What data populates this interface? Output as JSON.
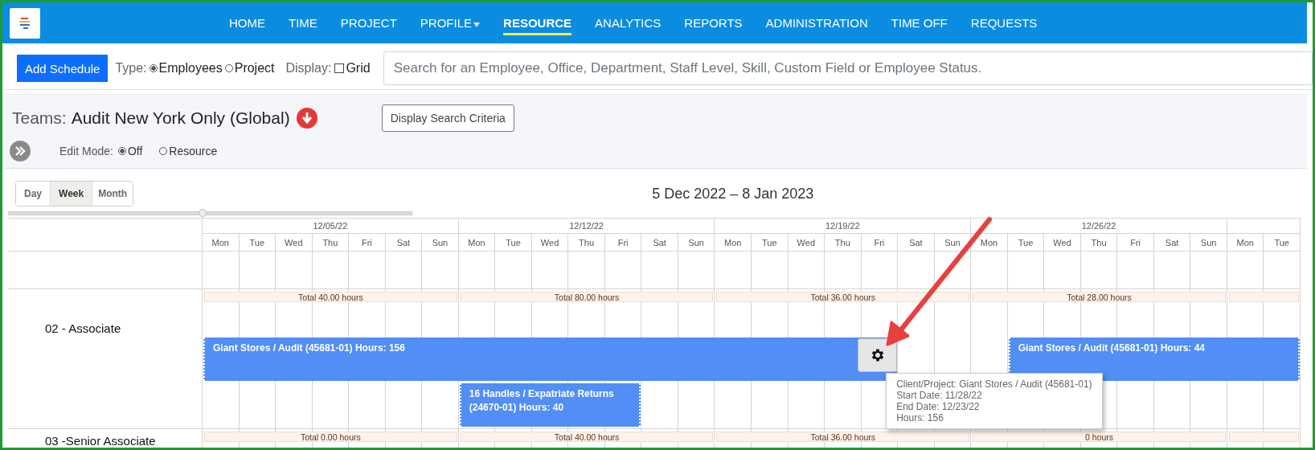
{
  "nav": {
    "items": [
      {
        "label": "HOME",
        "selected": false,
        "dropdown": false
      },
      {
        "label": "TIME",
        "selected": false,
        "dropdown": false
      },
      {
        "label": "PROJECT",
        "selected": false,
        "dropdown": false
      },
      {
        "label": "PROFILE",
        "selected": false,
        "dropdown": true
      },
      {
        "label": "RESOURCE",
        "selected": true,
        "dropdown": false
      },
      {
        "label": "ANALYTICS",
        "selected": false,
        "dropdown": false
      },
      {
        "label": "REPORTS",
        "selected": false,
        "dropdown": false
      },
      {
        "label": "ADMINISTRATION",
        "selected": false,
        "dropdown": false
      },
      {
        "label": "TIME OFF",
        "selected": false,
        "dropdown": false
      },
      {
        "label": "REQUESTS",
        "selected": false,
        "dropdown": false
      }
    ]
  },
  "toolbar": {
    "add_button": "Add Schedule",
    "type_label": "Type:",
    "type_options": [
      {
        "label": "Employees",
        "selected": true
      },
      {
        "label": "Project",
        "selected": false
      }
    ],
    "display_label": "Display:",
    "grid_option": {
      "label": "Grid",
      "checked": false
    },
    "search": {
      "placeholder": "Search for an Employee, Office, Department, Staff Level, Skill, Custom Field or Employee Status."
    }
  },
  "teams": {
    "label": "Teams:",
    "value": "Audit New York Only (Global)",
    "criteria_button": "Display Search Criteria"
  },
  "edit_mode": {
    "label": "Edit Mode:",
    "options": [
      {
        "label": "Off",
        "selected": true
      },
      {
        "label": "Resource",
        "selected": false
      }
    ]
  },
  "view_buttons": [
    {
      "label": "Day",
      "selected": false
    },
    {
      "label": "Week",
      "selected": true
    },
    {
      "label": "Month",
      "selected": false
    }
  ],
  "date_range": "5 Dec 2022 – 8 Jan 2023",
  "zoom_slider": {
    "level": 0.48
  },
  "timeline": {
    "weeks": [
      {
        "date": "12/05/22",
        "days": [
          "Mon",
          "Tue",
          "Wed",
          "Thu",
          "Fri",
          "Sat",
          "Sun"
        ]
      },
      {
        "date": "12/12/22",
        "days": [
          "Mon",
          "Tue",
          "Wed",
          "Thu",
          "Fri",
          "Sat",
          "Sun"
        ]
      },
      {
        "date": "12/19/22",
        "days": [
          "Mon",
          "Tue",
          "Wed",
          "Thu",
          "Fri",
          "Sat",
          "Sun"
        ]
      },
      {
        "date": "12/26/22",
        "days": [
          "Mon",
          "Tue",
          "Wed",
          "Thu",
          "Fri",
          "Sat",
          "Sun"
        ]
      },
      {
        "days": [
          "Mon",
          "Tue"
        ]
      }
    ],
    "rows": [
      {
        "label": "02 - Associate",
        "totals": [
          "Total 40.00 hours",
          "Total 80.00 hours",
          "Total 36.00 hours",
          "Total 28.00 hours"
        ],
        "lanes": [
          {
            "events": [
              {
                "title": "Giant Stores / Audit (45681-01) Hours: 156",
                "hovered": true,
                "tooltip": [
                  "Client/Project: Giant Stores / Audit (45681-01)",
                  "Start Date: 11/28/22",
                  "End Date: 12/23/22",
                  "Hours: 156"
                ]
              },
              {
                "title": "Giant Stores / Audit (45681-01) Hours: 44",
                "hovered": false
              }
            ]
          },
          {
            "events": [
              {
                "title": "16 Handles / Expatriate Returns (24670-01) Hours: 40",
                "hovered": false
              }
            ]
          }
        ]
      },
      {
        "label": "03 -Senior Associate",
        "totals": [
          "Total 0.00 hours",
          "Total 40.00 hours",
          "Total 36.00 hours",
          "0 hours"
        ],
        "lanes": []
      }
    ]
  }
}
